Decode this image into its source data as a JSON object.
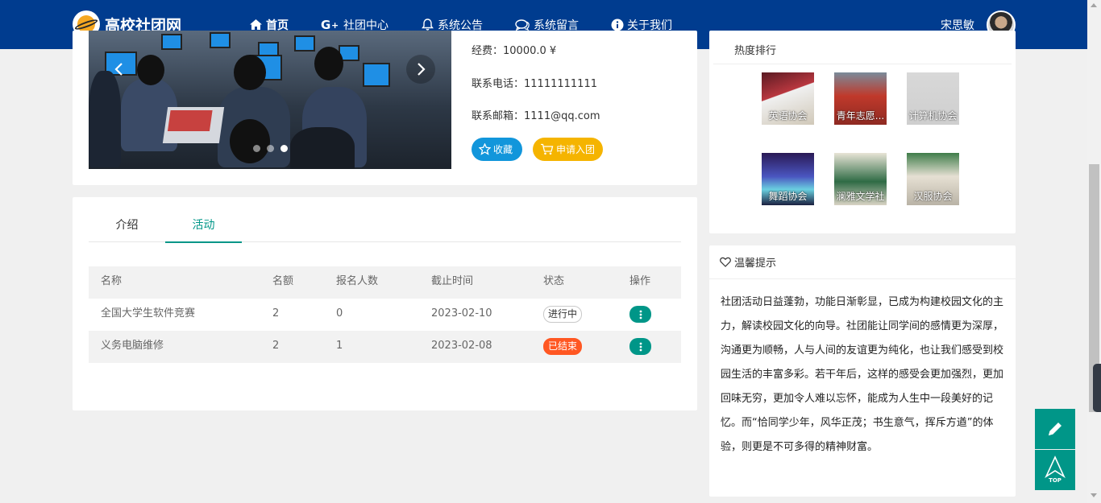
{
  "header": {
    "site_title": "高校社团网",
    "nav": [
      {
        "label": "首页",
        "icon": "home-icon"
      },
      {
        "label": "社团中心",
        "icon": "google-plus-icon"
      },
      {
        "label": "系统公告",
        "icon": "bell-icon"
      },
      {
        "label": "系统留言",
        "icon": "chat-icon"
      },
      {
        "label": "关于我们",
        "icon": "info-icon"
      }
    ],
    "user_name": "宋思敏"
  },
  "club_info": {
    "fee_line": "经费：10000.0 ¥",
    "phone_label": "联系电话：",
    "phone_value": "11111111111",
    "email_label": "联系邮箱：",
    "email_value": "1111@qq.com",
    "favorite_button": "收藏",
    "join_button": "申请入团",
    "carousel_slides": 3,
    "carousel_active": 3
  },
  "tabs": [
    {
      "label": "介绍",
      "active": false
    },
    {
      "label": "活动",
      "active": true
    }
  ],
  "activities": {
    "headers": [
      "名称",
      "名额",
      "报名人数",
      "截止时间",
      "状态",
      "操作"
    ],
    "rows": [
      {
        "name": "全国大学生软件竞赛",
        "quota": "2",
        "signed": "0",
        "deadline": "2023-02-10",
        "status": "进行中"
      },
      {
        "name": "义务电脑维修",
        "quota": "2",
        "signed": "1",
        "deadline": "2023-02-08",
        "status": "已结束"
      }
    ]
  },
  "hot_clubs": {
    "title": "热度排行",
    "items": [
      {
        "name": "英语协会"
      },
      {
        "name": "青年志愿..."
      },
      {
        "name": "计算机协会"
      },
      {
        "name": "舞蹈协会"
      },
      {
        "name": "澜雅文学社"
      },
      {
        "name": "汉服协会"
      }
    ]
  },
  "tips": {
    "title": "温馨提示",
    "body": "社团活动日益蓬勃，功能日渐彰显，已成为构建校园文化的主力，解读校园文化的向导。社团能让同学间的感情更为深厚，沟通更为顺畅，人与人间的友谊更为纯化，也让我们感受到校园生活的丰富多彩。若干年后，这样的感受会更加强烈，更加回味无穷，更加令人难以忘怀，能成为人生中一段美好的记忆。而“恰同学少年，风华正茂；书生意气，挥斥方遒”的体验，则更是不可多得的精神财富。"
  },
  "floating": {
    "top_label": "TOP"
  },
  "colors": {
    "header_bg": "#003c8f",
    "accent_teal": "#009688",
    "fav_blue": "#1296db",
    "join_yellow": "#f5b400",
    "ended_orange": "#ff5722"
  }
}
